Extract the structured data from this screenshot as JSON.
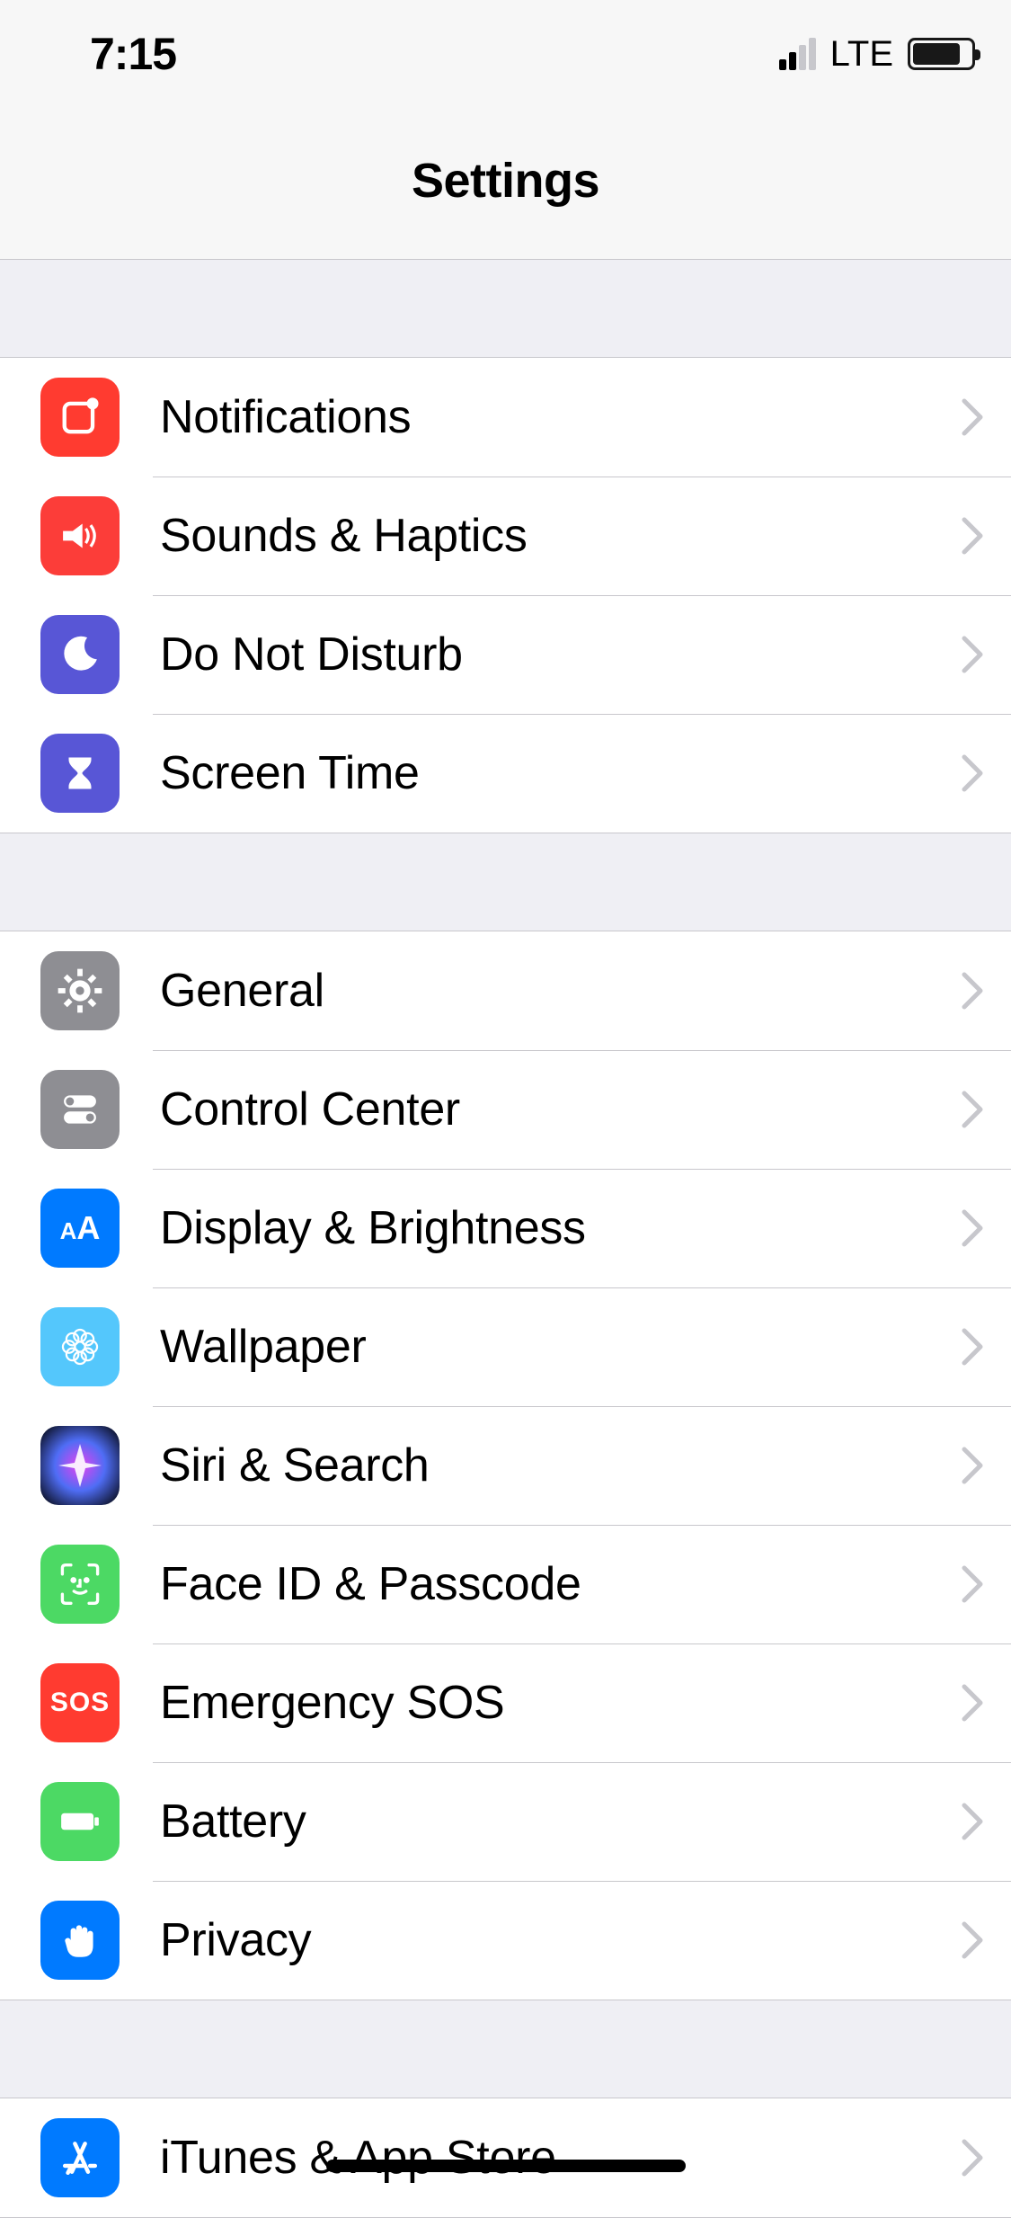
{
  "status": {
    "time": "7:15",
    "network": "LTE"
  },
  "header": {
    "title": "Settings"
  },
  "groups": [
    {
      "items": [
        {
          "id": "notifications",
          "label": "Notifications",
          "icon": "notifications-icon",
          "bg": "bg-red"
        },
        {
          "id": "sounds",
          "label": "Sounds & Haptics",
          "icon": "speaker-icon",
          "bg": "bg-pink"
        },
        {
          "id": "dnd",
          "label": "Do Not Disturb",
          "icon": "moon-icon",
          "bg": "bg-purple"
        },
        {
          "id": "screentime",
          "label": "Screen Time",
          "icon": "hourglass-icon",
          "bg": "bg-purple"
        }
      ]
    },
    {
      "items": [
        {
          "id": "general",
          "label": "General",
          "icon": "gear-icon",
          "bg": "bg-gray"
        },
        {
          "id": "controlcenter",
          "label": "Control Center",
          "icon": "toggles-icon",
          "bg": "bg-gray"
        },
        {
          "id": "display",
          "label": "Display & Brightness",
          "icon": "aa-icon",
          "bg": "bg-blue"
        },
        {
          "id": "wallpaper",
          "label": "Wallpaper",
          "icon": "flower-icon",
          "bg": "bg-sky"
        },
        {
          "id": "siri",
          "label": "Siri & Search",
          "icon": "siri-icon",
          "bg": "bg-siri"
        },
        {
          "id": "faceid",
          "label": "Face ID & Passcode",
          "icon": "faceid-icon",
          "bg": "bg-green"
        },
        {
          "id": "sos",
          "label": "Emergency SOS",
          "icon": "sos-icon",
          "bg": "bg-red"
        },
        {
          "id": "battery",
          "label": "Battery",
          "icon": "battery-icon",
          "bg": "bg-green"
        },
        {
          "id": "privacy",
          "label": "Privacy",
          "icon": "hand-icon",
          "bg": "bg-hand"
        }
      ]
    },
    {
      "items": [
        {
          "id": "appstore",
          "label": "iTunes & App Store",
          "icon": "appstore-icon",
          "bg": "bg-blue"
        }
      ]
    }
  ]
}
